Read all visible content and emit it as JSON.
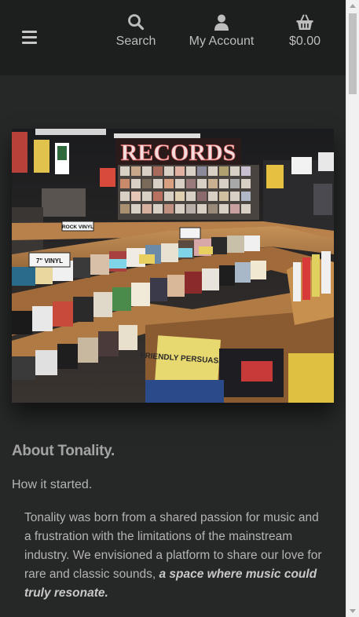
{
  "header": {
    "nav": {
      "search_label": "Search",
      "account_label": "My Account",
      "cart_label": "$0.00"
    }
  },
  "hero": {
    "sign_text": "RECORDS",
    "bin_labels": [
      "7\" VINYL",
      "ROCK VINYL"
    ],
    "album_text": "FRIENDLY PERSUASION"
  },
  "about": {
    "title": "About Tonality.",
    "subtitle": "How it started.",
    "body": "Tonality was born from a shared passion for music and a frustration with the limitations of the mainstream industry. We envisioned a platform to share our love for rare and classic sounds,",
    "emphasis": "a space where music could truly resonate."
  },
  "colors": {
    "background": "#262727",
    "header": "#1d1e1e",
    "text": "#b4b4b4",
    "heading": "#a3a3a3",
    "sign": "#f2dede"
  },
  "icons": [
    "menu-icon",
    "search-icon",
    "user-icon",
    "basket-icon"
  ]
}
